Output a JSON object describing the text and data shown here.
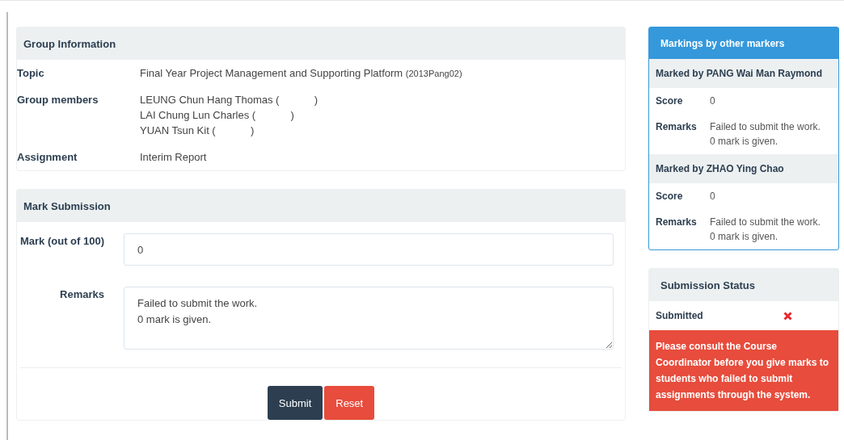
{
  "group_information": {
    "title": "Group Information",
    "topic": {
      "label": "Topic",
      "value": "Final Year Project Management and Supporting Platform",
      "code": "(2013Pang02)"
    },
    "members": {
      "label": "Group members",
      "values": [
        "LEUNG Chun Hang Thomas (            )",
        "LAI Chung Lun Charles (            )",
        "YUAN Tsun Kit (            )"
      ]
    },
    "assignment": {
      "label": "Assignment",
      "value": "Interim Report"
    }
  },
  "mark_submission": {
    "title": "Mark Submission",
    "mark": {
      "label": "Mark (out of 100)",
      "value": "0"
    },
    "remarks": {
      "label": "Remarks",
      "value": "Failed to submit the work.\n0 mark is given."
    },
    "buttons": [
      {
        "kind": "primary",
        "label": "Submit"
      },
      {
        "kind": "danger",
        "label": "Reset"
      }
    ]
  },
  "other_markings": {
    "title": "Markings by other markers",
    "markers": [
      {
        "title": "Marked by PANG Wai Man Raymond",
        "score_label": "Score",
        "score": "0",
        "remarks_label": "Remarks",
        "remarks": [
          "Failed to submit the work.",
          "0 mark is given."
        ]
      },
      {
        "title": "Marked by ZHAO Ying Chao",
        "score_label": "Score",
        "score": "0",
        "remarks_label": "Remarks",
        "remarks": [
          "Failed to submit the work.",
          "0 mark is given."
        ]
      }
    ]
  },
  "submission_status": {
    "title": "Submission Status",
    "label": "Submitted",
    "submitted": false,
    "alert": "Please consult the Course Coordinator before you give marks to students who failed to submit assignments through the system."
  }
}
